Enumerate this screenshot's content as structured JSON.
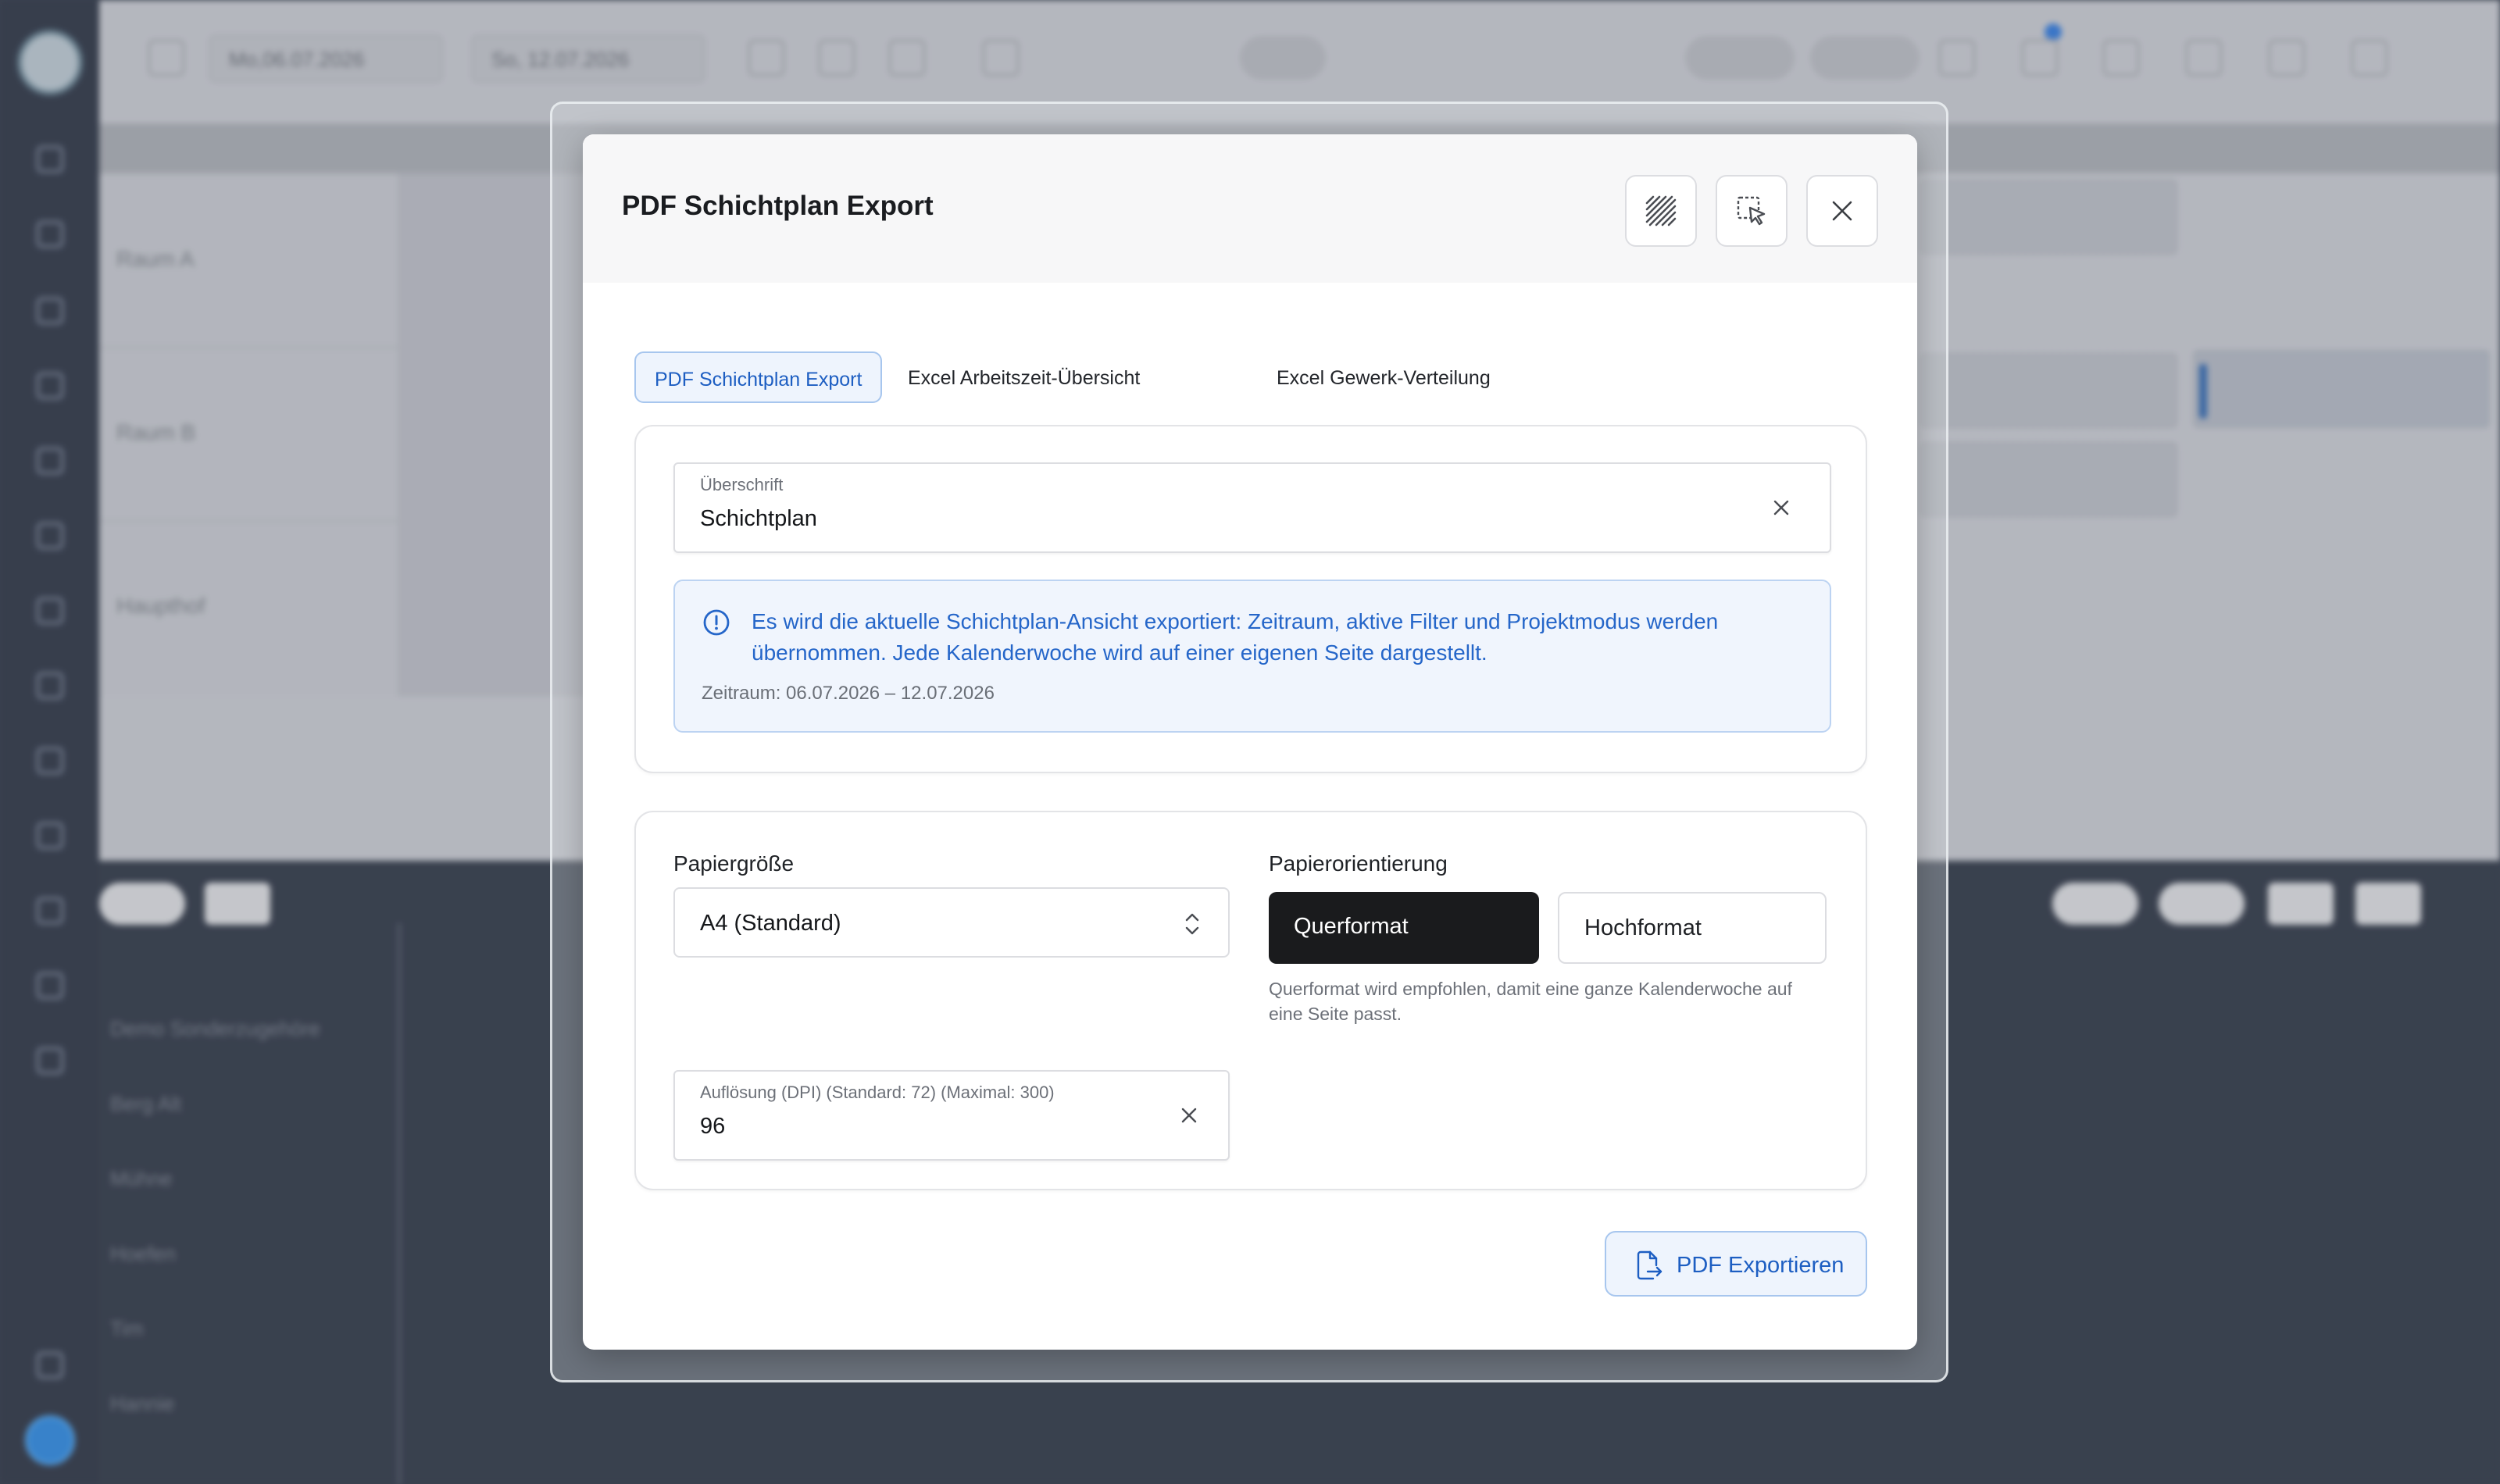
{
  "background": {
    "date_from": "Mo,06.07.2026",
    "date_to": "So, 12.07.2026",
    "rooms": [
      "Raum A",
      "Raum B",
      "Haupthof"
    ],
    "lower_rows": [
      "Demo Sonderzugehöre",
      "Berg Alt",
      "Mühne",
      "Hoefen",
      "Tim",
      "Hannie"
    ],
    "notification_dot_color": "#3d7fd8"
  },
  "modal": {
    "title": "PDF Schichtplan Export",
    "header_buttons": [
      {
        "name": "pattern-toggle-button",
        "icon": "hatch-pattern-icon"
      },
      {
        "name": "select-cursor-button",
        "icon": "select-cursor-icon"
      },
      {
        "name": "close-button",
        "icon": "close-icon"
      }
    ],
    "tabs": [
      {
        "label": "PDF Schichtplan Export",
        "active": true
      },
      {
        "label": "Excel Arbeitszeit-Übersicht",
        "active": false
      },
      {
        "label": "Excel Gewerk-Verteilung",
        "active": false
      }
    ],
    "heading_field": {
      "label": "Überschrift",
      "value": "Schichtplan"
    },
    "info": {
      "text": "Es wird die aktuelle Schichtplan-Ansicht exportiert: Zeitraum, aktive Filter und Projektmodus werden übernommen. Jede Kalenderwoche wird auf einer eigenen Seite dargestellt.",
      "range": "Zeitraum: 06.07.2026 – 12.07.2026",
      "icon": "info-circle-icon"
    },
    "paper_size": {
      "label": "Papiergröße",
      "value": "A4 (Standard)"
    },
    "orientation": {
      "label": "Papierorientierung",
      "options": [
        "Querformat",
        "Hochformat"
      ],
      "selected": "Querformat",
      "hint": "Querformat wird empfohlen, damit eine ganze Kalenderwoche auf eine Seite passt."
    },
    "dpi_field": {
      "label": "Auflösung (DPI) (Standard: 72) (Maximal: 300)",
      "value": "96"
    },
    "export_button": {
      "label": "PDF Exportieren",
      "icon": "file-export-icon"
    },
    "colors": {
      "accent": "#1d5ec2",
      "accent_bg": "#eef4fd",
      "selected_option": "#1a1b1d"
    }
  }
}
